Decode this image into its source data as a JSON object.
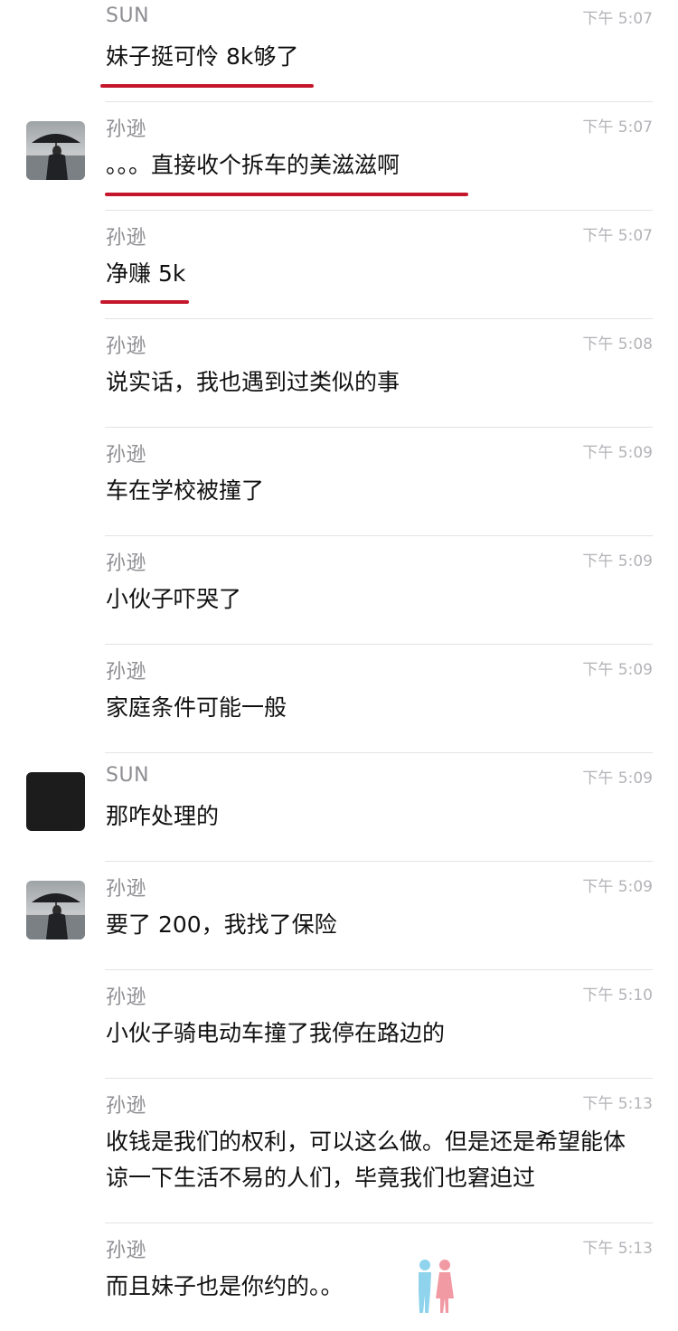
{
  "messages": [
    {
      "sender": "SUN",
      "time": "下午 5:07",
      "text": "妹子挺可怜 8k够了",
      "avatar": "none",
      "underline": true
    },
    {
      "sender": "孙逊",
      "time": "下午 5:07",
      "text": "。。。直接收个拆车的美滋滋啊",
      "avatar": "umbrella",
      "underline": true
    },
    {
      "sender": "孙逊",
      "time": "下午 5:07",
      "text": "净赚 5k",
      "avatar": "none",
      "underline": true
    },
    {
      "sender": "孙逊",
      "time": "下午 5:08",
      "text": "说实话，我也遇到过类似的事",
      "avatar": "none",
      "underline": false
    },
    {
      "sender": "孙逊",
      "time": "下午 5:09",
      "text": "车在学校被撞了",
      "avatar": "none",
      "underline": false
    },
    {
      "sender": "孙逊",
      "time": "下午 5:09",
      "text": "小伙子吓哭了",
      "avatar": "none",
      "underline": false
    },
    {
      "sender": "孙逊",
      "time": "下午 5:09",
      "text": "家庭条件可能一般",
      "avatar": "none",
      "underline": false
    },
    {
      "sender": "SUN",
      "time": "下午 5:09",
      "text": "那咋处理的",
      "avatar": "black",
      "underline": false
    },
    {
      "sender": "孙逊",
      "time": "下午 5:09",
      "text": "要了 200，我找了保险",
      "avatar": "umbrella",
      "underline": false
    },
    {
      "sender": "孙逊",
      "time": "下午 5:10",
      "text": "小伙子骑电动车撞了我停在路边的",
      "avatar": "none",
      "underline": false
    },
    {
      "sender": "孙逊",
      "time": "下午 5:13",
      "text": "收钱是我们的权利，可以这么做。但是还是希望能体谅一下生活不易的人们，毕竟我们也窘迫过",
      "avatar": "none",
      "underline": false
    },
    {
      "sender": "孙逊",
      "time": "下午 5:13",
      "text": "而且妹子也是你约的。。",
      "avatar": "none",
      "underline": false
    }
  ],
  "colors": {
    "underline": "#c4172c",
    "name": "#8e8e93",
    "time": "#b3b3b8",
    "text": "#111111"
  },
  "icons": {
    "watermark": "couple-figures-icon",
    "avatar_photo": "umbrella-person-photo"
  }
}
